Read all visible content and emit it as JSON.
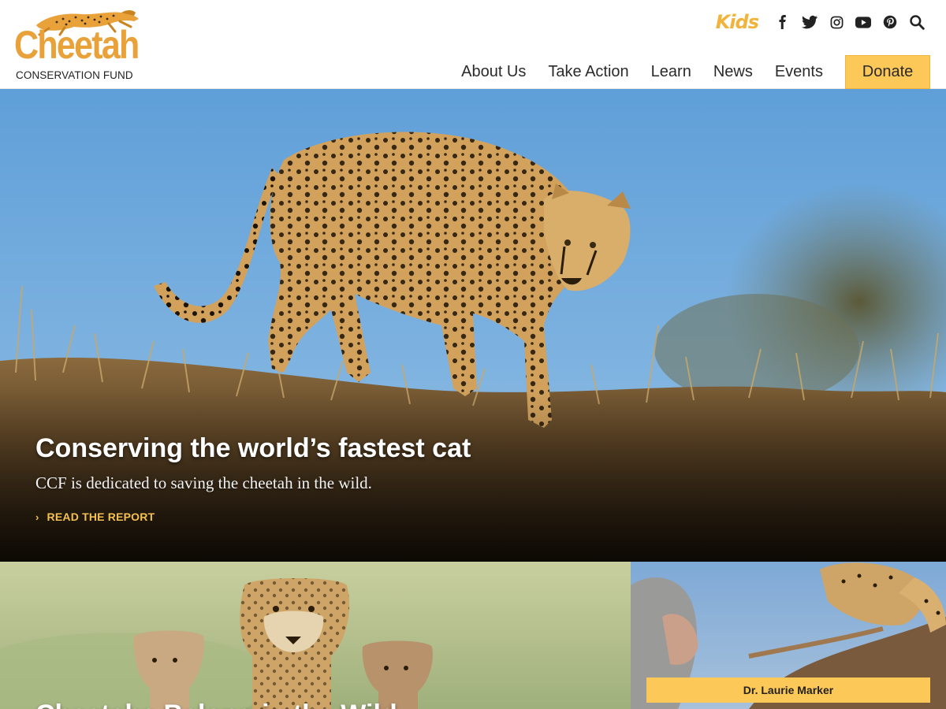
{
  "brand": {
    "name": "Cheetah",
    "subtitle": "CONSERVATION FUND",
    "accent": "#e9a139",
    "button_color": "#fcc858"
  },
  "topbar": {
    "kids_label": "Kids",
    "icons": [
      "facebook-icon",
      "twitter-icon",
      "instagram-icon",
      "youtube-icon",
      "pinterest-icon",
      "search-icon"
    ]
  },
  "nav": {
    "items": [
      "About Us",
      "Take Action",
      "Learn",
      "News",
      "Events"
    ],
    "donate_label": "Donate"
  },
  "hero": {
    "title": "Conserving the world’s fastest cat",
    "subtitle": "CCF is dedicated to saving the cheetah in the wild.",
    "cta_label": "READ THE REPORT"
  },
  "cards": {
    "left_title": "Cheetahs Belong in the Wild",
    "right_caption": "Dr. Laurie Marker"
  }
}
